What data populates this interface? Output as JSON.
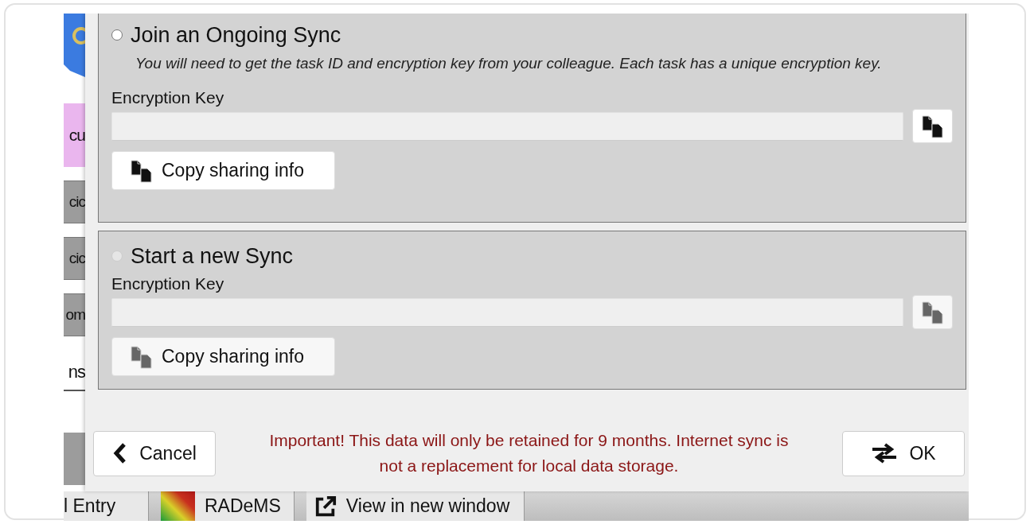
{
  "background_app": {
    "side_items": [
      {
        "text": "cu",
        "kind": "pink"
      },
      {
        "text": "cic",
        "kind": "gray"
      },
      {
        "text": "cic",
        "kind": "gray"
      },
      {
        "text": "om",
        "kind": "gray"
      },
      {
        "text": "ns",
        "kind": "plain"
      },
      {
        "kind": "grayblock"
      }
    ],
    "bottom_tabs": [
      {
        "label": "l Entry",
        "kind": "text"
      },
      {
        "label": "RADeMS",
        "kind": "colored"
      },
      {
        "label": "View in new window",
        "kind": "popout"
      }
    ]
  },
  "sections": [
    {
      "title": "Join an Ongoing Sync",
      "selected": false,
      "disabled": false,
      "description": "You will need to get the task ID and encryption key from your colleague.  Each task has a unique encryption key.",
      "field_label": "Encryption Key",
      "copy_button": "Copy sharing info"
    },
    {
      "title": "Start a new Sync",
      "selected": false,
      "disabled": true,
      "field_label": "Encryption Key",
      "copy_button": "Copy sharing info"
    }
  ],
  "footer": {
    "cancel": "Cancel",
    "message": "Important! This data will only be retained for 9 months. Internet sync is not a replacement for local data storage.",
    "ok": "OK"
  }
}
